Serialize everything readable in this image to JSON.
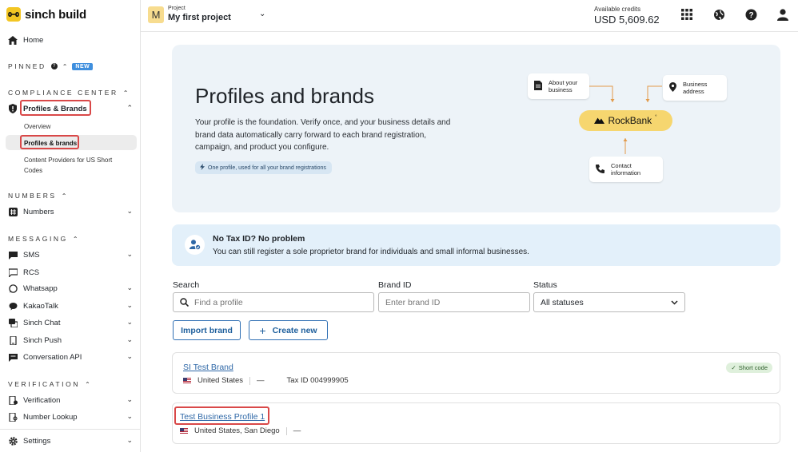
{
  "brand": {
    "logo_text": "sinch build"
  },
  "sidebar": {
    "home": "Home",
    "pinned": {
      "label": "PINNED",
      "badge": "NEW"
    },
    "compliance": {
      "label": "COMPLIANCE CENTER",
      "profiles_brands": "Profiles & Brands",
      "sub": [
        "Overview",
        "Profiles & brands",
        "Content Providers for US Short Codes"
      ]
    },
    "numbers": {
      "label": "NUMBERS",
      "items": [
        "Numbers"
      ]
    },
    "messaging": {
      "label": "MESSAGING",
      "items": [
        "SMS",
        "RCS",
        "Whatsapp",
        "KakaoTalk",
        "Sinch Chat",
        "Sinch Push",
        "Conversation API"
      ]
    },
    "verification": {
      "label": "VERIFICATION",
      "items": [
        "Verification",
        "Number Lookup"
      ]
    },
    "settings": "Settings"
  },
  "topbar": {
    "project_badge": "M",
    "project_label": "Project",
    "project_name": "My first project",
    "credits_label": "Available credits",
    "credits_value": "USD 5,609.62"
  },
  "hero": {
    "title": "Profiles and brands",
    "description": "Your profile is the foundation. Verify once, and your business details and brand data automatically carry forward to each brand registration, campaign, and product you configure.",
    "pill": "One profile, used for all your brand registrations",
    "cards": {
      "about": "About your business",
      "address": "Business address",
      "contact": "Contact information"
    },
    "rockbank": "RockBank"
  },
  "info": {
    "title": "No Tax ID? No problem",
    "description": "You can still register a sole proprietor brand for individuals and small informal businesses."
  },
  "filters": {
    "search_label": "Search",
    "search_placeholder": "Find a profile",
    "brand_label": "Brand ID",
    "brand_placeholder": "Enter brand ID",
    "status_label": "Status",
    "status_value": "All statuses"
  },
  "actions": {
    "import": "Import brand",
    "create": "Create new"
  },
  "profiles": [
    {
      "name": "SI Test Brand",
      "location": "United States",
      "dash": "—",
      "tax": "Tax ID 004999905",
      "badge": "Short code"
    },
    {
      "name": "Test Business Profile 1",
      "location": "United States, San Diego",
      "dash": "—"
    }
  ],
  "colors": {
    "accent_yellow": "#f3c623",
    "link_blue": "#2f68a7",
    "highlight_red": "#d94848"
  }
}
